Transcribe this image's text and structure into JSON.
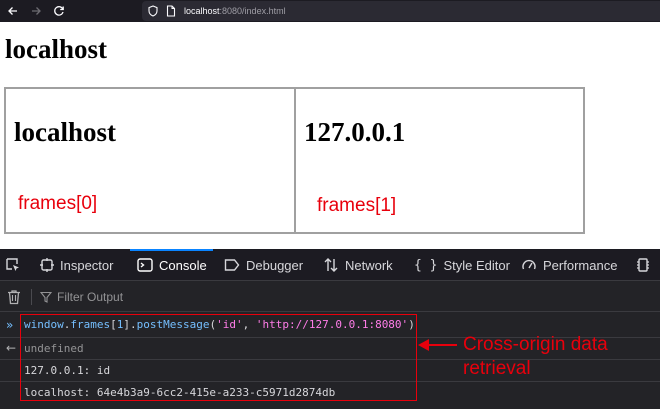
{
  "browser": {
    "url_host": "localhost",
    "url_path": ":8080/index.html"
  },
  "page": {
    "title": "localhost",
    "frames": [
      {
        "heading": "localhost",
        "annotation": "frames[0]"
      },
      {
        "heading": "127.0.0.1",
        "annotation": "frames[1]"
      }
    ]
  },
  "devtools": {
    "tabs": [
      {
        "label": "Inspector",
        "icon": "inspector-icon"
      },
      {
        "label": "Console",
        "icon": "console-icon",
        "active": true
      },
      {
        "label": "Debugger",
        "icon": "debugger-icon"
      },
      {
        "label": "Network",
        "icon": "network-icon"
      },
      {
        "label": "Style Editor",
        "icon": "style-editor-icon"
      },
      {
        "label": "Performance",
        "icon": "performance-icon"
      }
    ],
    "filter_placeholder": "Filter Output",
    "console": {
      "input": {
        "obj": "window",
        "prop1": "frames",
        "index": "1",
        "method": "postMessage",
        "arg1": "'id'",
        "arg2": "'http://127.0.0.1:8080'"
      },
      "result": "undefined",
      "logs": [
        "127.0.0.1: id",
        "localhost: 64e4b3a9-6cc2-415e-a233-c5971d2874db"
      ]
    }
  },
  "annotation": {
    "text": "Cross-origin data retrieval",
    "color": "#e8000c"
  },
  "colors": {
    "toolbar_bg": "#1c1b22",
    "devtools_bg": "#232327",
    "active_tab_accent": "#0a84ff"
  }
}
